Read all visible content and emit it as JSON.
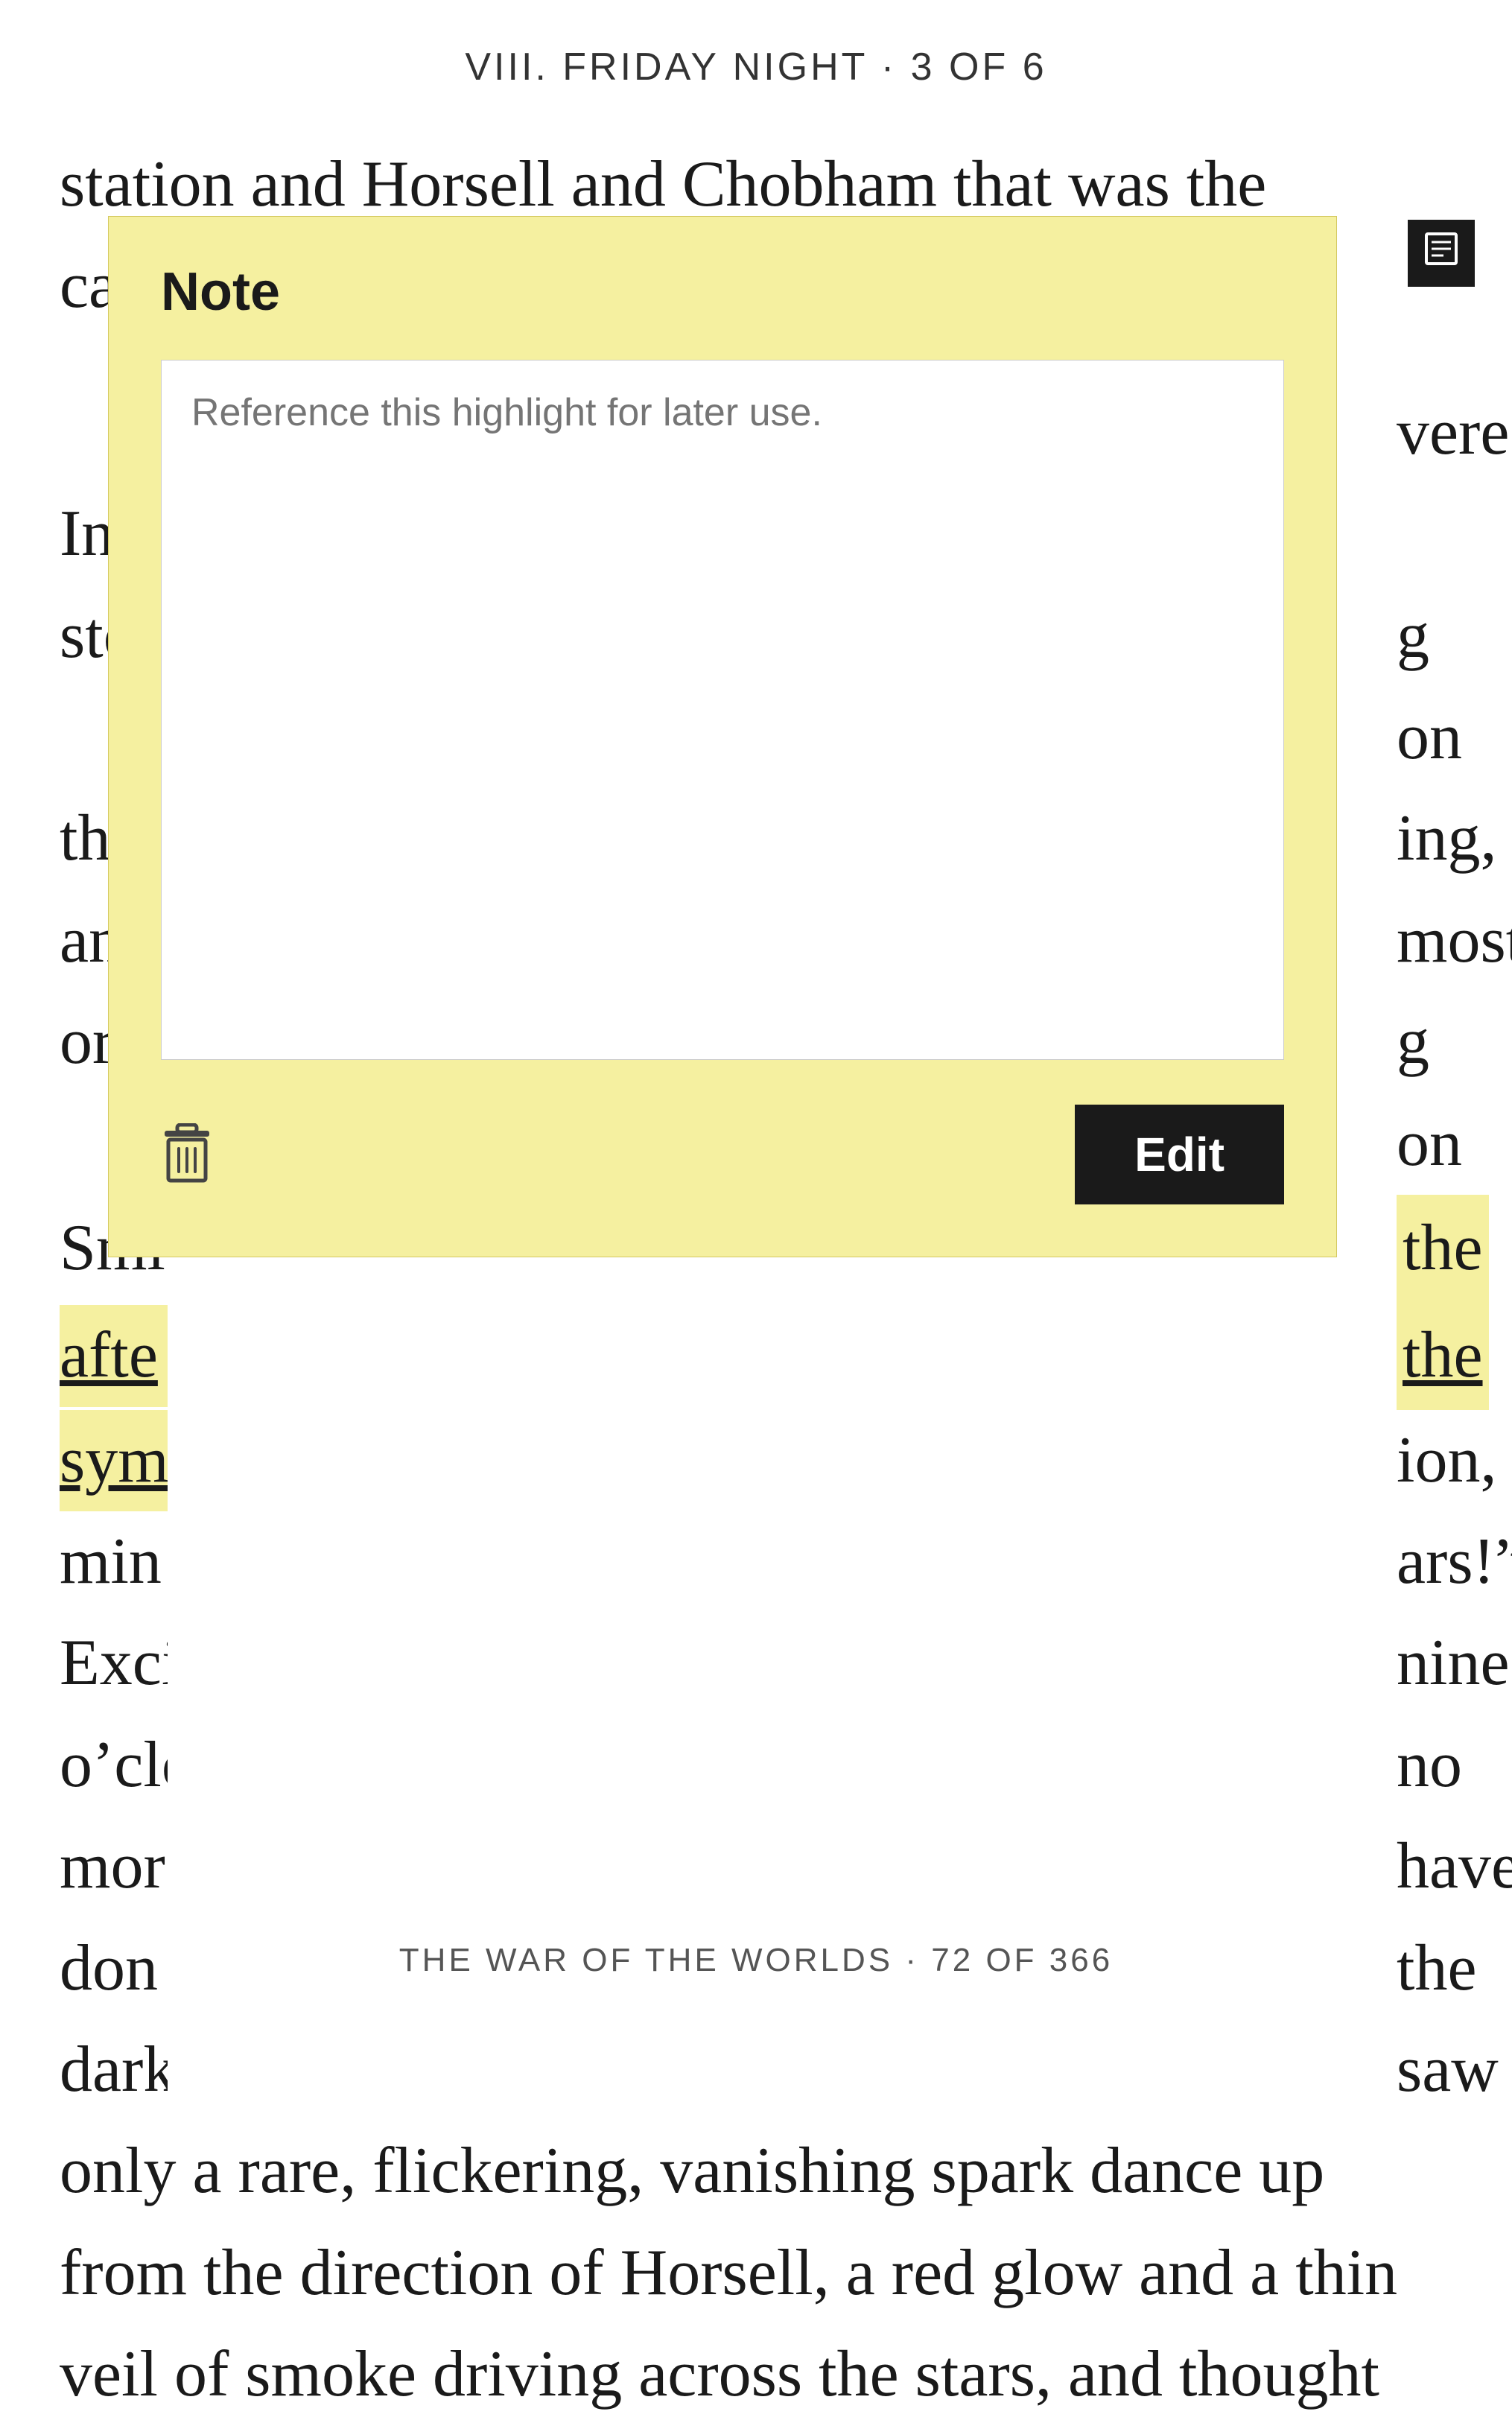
{
  "header": {
    "chapter": "VIII. FRIDAY NIGHT",
    "page_info": "3 OF 6"
  },
  "book_text": {
    "line1": "station and Horsell and Chobham that was the",
    "line2": "case.",
    "paragraph_lines": [
      "In",
      "stop",
      "the",
      "and",
      "ordi",
      "Smi",
      "afte",
      "sym",
      "min",
      "Exci",
      "o'clo",
      "mor",
      "don",
      "dark"
    ],
    "right_words": [
      "vere",
      "g on",
      "ting,",
      "nost",
      "g on",
      "the",
      "the",
      "ion,",
      "ars!”",
      "nine",
      "no",
      "nave",
      "the",
      "saw"
    ],
    "bottom_lines": [
      "only a rare, flickering, vanishing spark dance up",
      "from the direction of Horsell, a red glow and a thin",
      "veil of smoke driving across the stars, and thought"
    ]
  },
  "note": {
    "title": "Note",
    "placeholder": "Reference this highlight for later use.",
    "content": "",
    "delete_label": "Delete",
    "edit_label": "Edit"
  },
  "footer": {
    "book_title": "THE WAR OF THE WORLDS",
    "page_info": "72 OF 366"
  },
  "colors": {
    "highlight": "#f5f0a0",
    "background": "#ffffff",
    "text": "#1a1a1a",
    "note_bg": "#f5f0a0",
    "button_bg": "#1a1a1a",
    "button_text": "#ffffff"
  }
}
